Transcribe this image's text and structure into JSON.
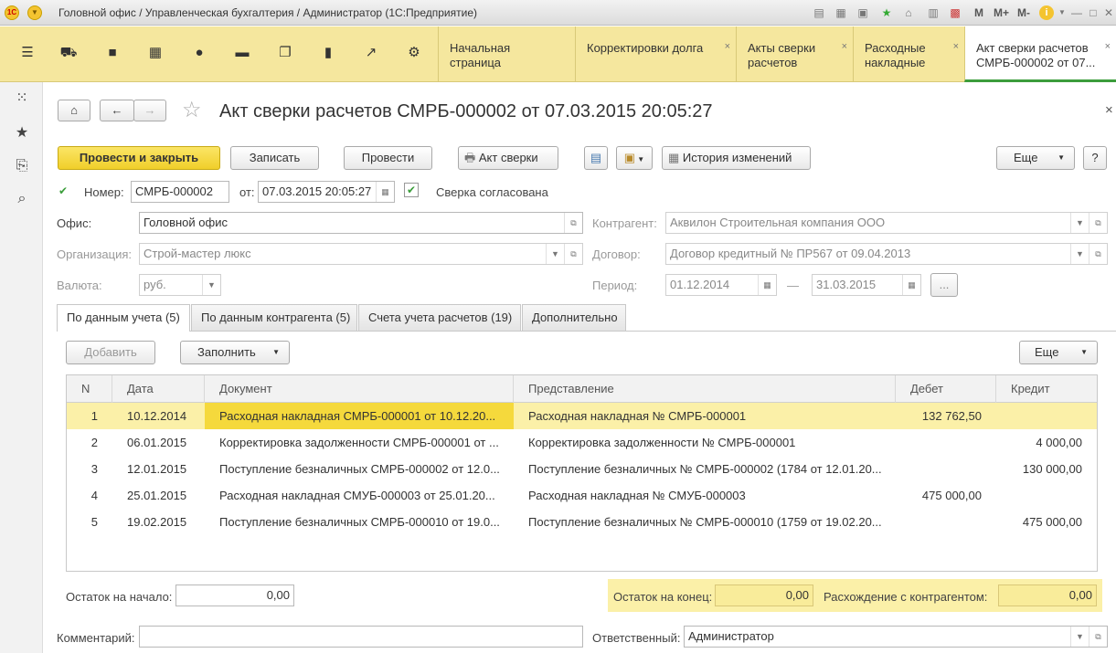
{
  "titlebar": {
    "title": "Головной офис / Управленческая бухгалтерия / Администратор  (1С:Предприятие)",
    "m_label": "M",
    "mplus_label": "M+",
    "mminus_label": "M-",
    "info_icon": "i"
  },
  "sections": [
    "menu-icon",
    "cart-icon",
    "bag-icon",
    "grid-icon",
    "ruble-icon",
    "truck-icon",
    "docs-icon",
    "barchart-icon",
    "trend-icon",
    "gear-icon"
  ],
  "tabs": [
    {
      "label": "Начальная страница",
      "close": ""
    },
    {
      "label": "Корректировки долга",
      "close": "×"
    },
    {
      "label": "Акты сверки расчетов",
      "close": "×"
    },
    {
      "label": "Расходные накладные",
      "close": "×"
    },
    {
      "label": "Акт сверки расчетов СМРБ-000002 от 07...",
      "close": "×"
    }
  ],
  "doc": {
    "title": "Акт сверки расчетов СМРБ-000002 от 07.03.2015 20:05:27",
    "close": "×"
  },
  "toolbar": {
    "post_close": "Провести и закрыть",
    "save": "Записать",
    "post": "Провести",
    "print_act": "Акт сверки",
    "history": "История изменений",
    "more": "Еще",
    "help": "?"
  },
  "form": {
    "number_label": "Номер:",
    "number_value": "СМРБ-000002",
    "date_label": "от:",
    "date_value": "07.03.2015 20:05:27",
    "agreed_label": "Сверка согласована",
    "office_label": "Офис:",
    "office_value": "Головной офис",
    "org_label": "Организация:",
    "org_value": "Строй-мастер люкс",
    "currency_label": "Валюта:",
    "currency_value": "руб.",
    "counterparty_label": "Контрагент:",
    "counterparty_value": "Аквилон Строительная компания ООО",
    "contract_label": "Договор:",
    "contract_value": "Договор кредитный № ПР567 от 09.04.2013",
    "period_label": "Период:",
    "period_from": "01.12.2014",
    "period_dash": "—",
    "period_to": "31.03.2015",
    "period_more": "..."
  },
  "subtabs": [
    "По данным учета (5)",
    "По данным контрагента (5)",
    "Счета учета расчетов (19)",
    "Дополнительно"
  ],
  "table_toolbar": {
    "add": "Добавить",
    "fill": "Заполнить",
    "more": "Еще"
  },
  "table": {
    "headers": [
      "N",
      "Дата",
      "Документ",
      "Представление",
      "Дебет",
      "Кредит"
    ],
    "rows": [
      [
        "1",
        "10.12.2014",
        "Расходная накладная СМРБ-000001 от 10.12.20...",
        "Расходная накладная № СМРБ-000001",
        "132 762,50",
        ""
      ],
      [
        "2",
        "06.01.2015",
        "Корректировка задолженности СМРБ-000001 от ...",
        "Корректировка задолженности № СМРБ-000001",
        "",
        "4 000,00"
      ],
      [
        "3",
        "12.01.2015",
        "Поступление безналичных СМРБ-000002 от 12.0...",
        "Поступление безналичных № СМРБ-000002 (1784 от 12.01.20...",
        "",
        "130 000,00"
      ],
      [
        "4",
        "25.01.2015",
        "Расходная накладная СМУБ-000003 от 25.01.20...",
        "Расходная накладная № СМУБ-000003",
        "475 000,00",
        ""
      ],
      [
        "5",
        "19.02.2015",
        "Поступление безналичных СМРБ-000010 от 19.0...",
        "Поступление безналичных № СМРБ-000010 (1759 от 19.02.20...",
        "",
        "475 000,00"
      ]
    ]
  },
  "totals": {
    "start_label": "Остаток на начало:",
    "start_value": "0,00",
    "end_label": "Остаток на конец:",
    "end_value": "0,00",
    "diff_label": "Расхождение с контрагентом:",
    "diff_value": "0,00"
  },
  "footer": {
    "comment_label": "Комментарий:",
    "comment_value": "",
    "responsible_label": "Ответственный:",
    "responsible_value": "Администратор"
  },
  "colors": {
    "accent": "#f5e79e",
    "primary_button": "#f0cf2a",
    "selected_row": "#fbf0a8"
  }
}
